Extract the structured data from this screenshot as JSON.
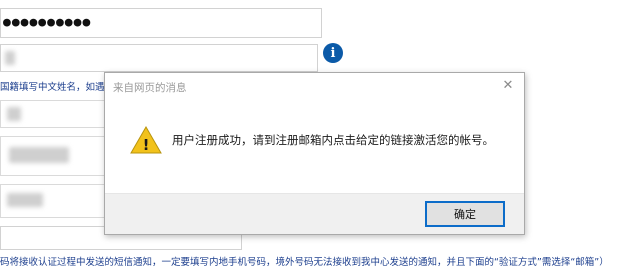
{
  "form": {
    "password_value": "●●●●●●●●●●",
    "info_icon_glyph": "i",
    "name_hint": "国籍填写中文姓名，如遇",
    "phone_hint": "码将接收认证过程中发送的短信通知，一定要填写内地手机号码，境外号码无法接收到我中心发送的通知，并且下面的“验证方式”需选择“邮箱”）"
  },
  "dialog": {
    "title": "来自网页的消息",
    "close_glyph": "✕",
    "message": "用户注册成功，请到注册邮箱内点击给定的链接激活您的帐号。",
    "ok_label": "确定",
    "warning_symbol": "!",
    "colors": {
      "warning_fill": "#f2c21b",
      "button_border": "#0c6cc9",
      "footer_bg": "#f0f0f0"
    }
  }
}
